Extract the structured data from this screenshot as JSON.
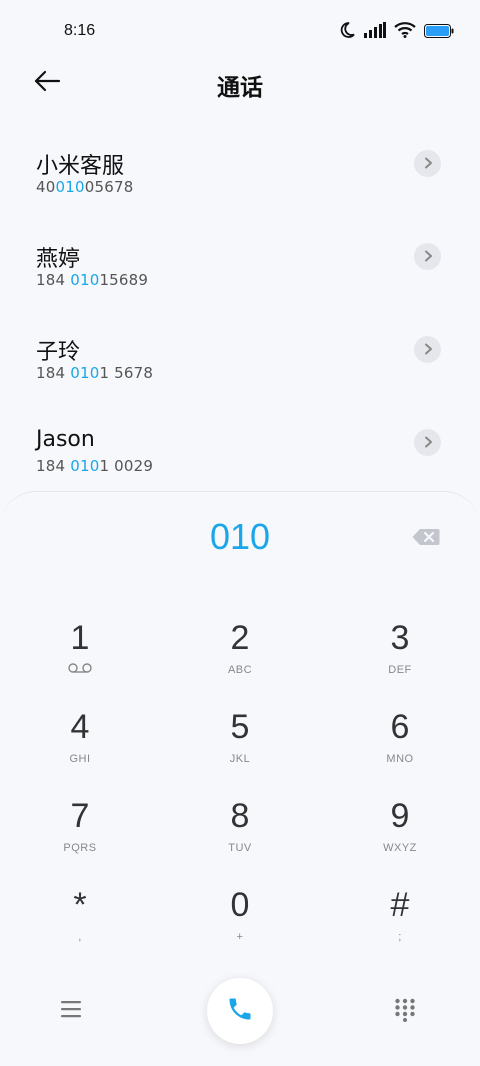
{
  "status_bar": {
    "time": "8:16",
    "icons": [
      "moon-icon",
      "signal-icon",
      "wifi-icon",
      "battery-icon"
    ],
    "battery_color": "#2a9df4"
  },
  "header": {
    "title": "通话",
    "back_icon": "back-arrow-icon"
  },
  "contacts": [
    {
      "name": "小米客服",
      "number_pre": "40",
      "number_match": "010",
      "number_post": "05678"
    },
    {
      "name": "燕婷",
      "number_pre": "184 ",
      "number_match": "010",
      "number_post": "15689"
    },
    {
      "name": "子玲",
      "number_pre": "184 ",
      "number_match": "010",
      "number_post": "1 5678"
    },
    {
      "name": "Jason",
      "number_pre": "184 ",
      "number_match": "010",
      "number_post": "1 0029"
    }
  ],
  "dialer": {
    "input_value": "010",
    "accent_color": "#1aa6e8",
    "keys": [
      {
        "digit": "1",
        "sub": ""
      },
      {
        "digit": "2",
        "sub": "ABC"
      },
      {
        "digit": "3",
        "sub": "DEF"
      },
      {
        "digit": "4",
        "sub": "GHI"
      },
      {
        "digit": "5",
        "sub": "JKL"
      },
      {
        "digit": "6",
        "sub": "MNO"
      },
      {
        "digit": "7",
        "sub": "PQRS"
      },
      {
        "digit": "8",
        "sub": "TUV"
      },
      {
        "digit": "9",
        "sub": "WXYZ"
      },
      {
        "digit": "*",
        "sub": ","
      },
      {
        "digit": "0",
        "sub": "+"
      },
      {
        "digit": "#",
        "sub": ";"
      }
    ]
  }
}
